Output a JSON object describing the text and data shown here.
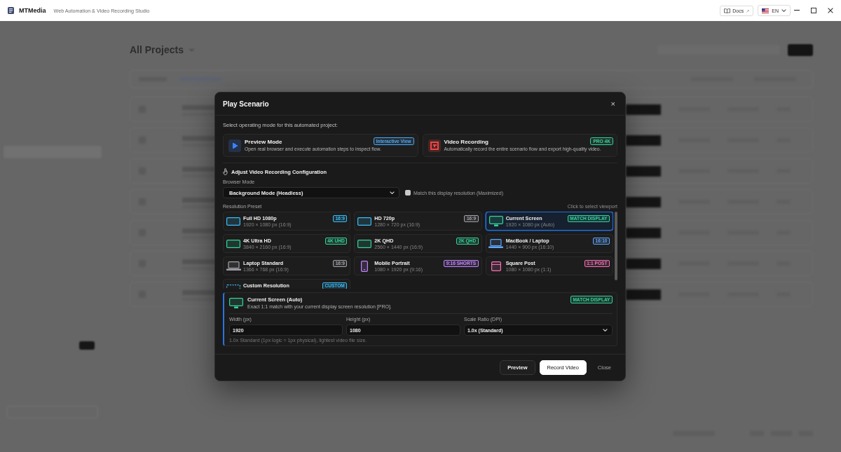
{
  "title_bar": {
    "app_name": "MTMedia",
    "subtitle": "Web Automation & Video Recording Studio",
    "docs_button": {
      "label": "Docs",
      "arrow": "↗"
    },
    "language": "EN"
  },
  "backdrop": {
    "heading": "All Projects"
  },
  "dialog": {
    "title": "Play Scenario",
    "close": "×",
    "mode_prompt": "Select operating mode for this automated project:",
    "modes": [
      {
        "kind": "preview",
        "title": "Preview Mode",
        "description": "Open real browser and execute automation steps to inspect flow.",
        "badge": {
          "label": "Interactive View",
          "color": "#4ea8f5"
        },
        "color": "#3b82f6"
      },
      {
        "kind": "record",
        "title": "Video Recording",
        "description": "Automatically record the entire scenario flow and export high-quality video.",
        "badge": {
          "label": "PRO 4K",
          "color": "#34d399"
        },
        "color": "#ef4444"
      }
    ],
    "config_heading": "Adjust Video Recording Configuration",
    "browser_mode": {
      "label": "Browser Mode",
      "value": "Background Mode (Headless)"
    },
    "match_display": {
      "label": "Match this display resolution (Maximized)",
      "checked": false
    },
    "presets_label": "Resolution Preset",
    "presets_hint": "Click to select viewport",
    "presets": [
      {
        "kind": "monitor",
        "title": "Full HD 1080p",
        "size": "1920 × 1080 px (16:9)",
        "badge": {
          "label": "16:9",
          "color": "#38bdf8"
        },
        "color": "#38bdf8",
        "selected": false
      },
      {
        "kind": "monitor",
        "title": "HD 720p",
        "size": "1280 × 720 px (16:9)",
        "badge": {
          "label": "16:9",
          "color": "#a1a1aa"
        },
        "color": "#38bdf8",
        "selected": false
      },
      {
        "kind": "display",
        "title": "Current Screen",
        "size": "1920 × 1080 px (Auto)",
        "badge": {
          "label": "MATCH DISPLAY",
          "color": "#34d399"
        },
        "color": "#34d399",
        "selected": true
      },
      {
        "kind": "monitor",
        "title": "4K Ultra HD",
        "size": "3840 × 2160 px (16:9)",
        "badge": {
          "label": "4K UHD",
          "color": "#34d399"
        },
        "color": "#34d399",
        "selected": false
      },
      {
        "kind": "monitor",
        "title": "2K QHD",
        "size": "2560 × 1440 px (16:9)",
        "badge": {
          "label": "2K QHD",
          "color": "#34d399"
        },
        "color": "#34d399",
        "selected": false
      },
      {
        "kind": "laptop",
        "title": "MacBook / Laptop",
        "size": "1440 × 900 px (16:10)",
        "badge": {
          "label": "16:10",
          "color": "#60a5fa"
        },
        "color": "#60a5fa",
        "selected": false
      },
      {
        "kind": "laptop",
        "title": "Laptop Standard",
        "size": "1366 × 768 px (16:9)",
        "badge": {
          "label": "16:9",
          "color": "#a1a1aa"
        },
        "color": "#a1a1aa",
        "selected": false
      },
      {
        "kind": "phone",
        "title": "Mobile Portrait",
        "size": "1080 × 1920 px (9:16)",
        "badge": {
          "label": "9:16 SHORTS",
          "color": "#c084fc"
        },
        "color": "#c084fc",
        "selected": false
      },
      {
        "kind": "square",
        "title": "Square Post",
        "size": "1080 × 1080 px (1:1)",
        "badge": {
          "label": "1:1 POST",
          "color": "#f472b6"
        },
        "color": "#f472b6",
        "selected": false
      },
      {
        "kind": "custom",
        "title": "Custom Resolution",
        "badge": {
          "label": "CUSTOM",
          "color": "#38bdf8"
        },
        "color": "#38bdf8",
        "selected": false
      }
    ],
    "detail": {
      "kind": "display",
      "title": "Current Screen (Auto)",
      "description": "Exact 1:1 match with your current display screen resolution [PRO].",
      "badge": {
        "label": "MATCH DISPLAY",
        "color": "#34d399"
      },
      "color": "#34d399",
      "fields": [
        {
          "kind": "input",
          "label": "Width (px)",
          "value": "1920"
        },
        {
          "kind": "input",
          "label": "Height (px)",
          "value": "1080"
        },
        {
          "kind": "select",
          "label": "Scale Ratio (DPI)",
          "value": "1.0x (Standard)"
        }
      ],
      "hint": "1.0x Standard (1px logic = 1px physical), lightest video file size."
    },
    "buttons": [
      {
        "kind": "secondary",
        "label": "Preview"
      },
      {
        "kind": "primary",
        "label": "Record Video"
      },
      {
        "kind": "plain",
        "label": "Close"
      }
    ]
  }
}
